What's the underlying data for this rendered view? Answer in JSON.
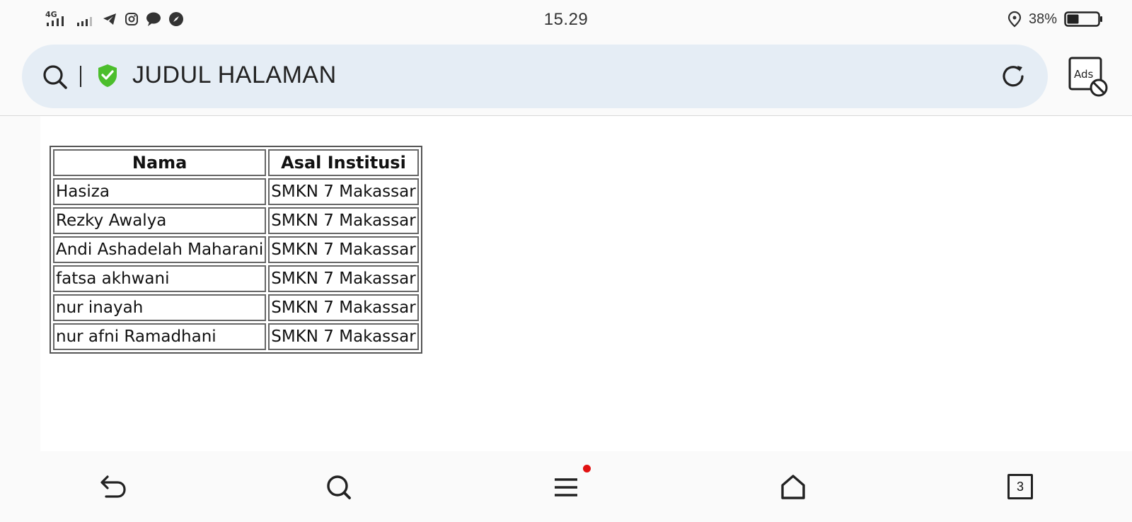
{
  "status_bar": {
    "network": "4G",
    "time": "15.29",
    "battery_percent": "38%",
    "battery_level": 0.38,
    "icons": [
      "signal-icon",
      "signal-icon",
      "telegram-icon",
      "instagram-icon",
      "chat-icon",
      "compass-icon",
      "location-icon",
      "battery-icon"
    ]
  },
  "address_bar": {
    "title": "JUDUL HALAMAN",
    "secure_color": "#4cbe2c"
  },
  "ads_button": {
    "label": "Ads"
  },
  "table": {
    "headers": [
      "Nama",
      "Asal Institusi"
    ],
    "rows": [
      [
        "Hasiza",
        "SMKN 7 Makassar"
      ],
      [
        "Rezky Awalya",
        "SMKN 7 Makassar"
      ],
      [
        "Andi Ashadelah Maharani",
        "SMKN 7 Makassar"
      ],
      [
        "fatsa akhwani",
        "SMKN 7 Makassar"
      ],
      [
        "nur inayah",
        "SMKN 7 Makassar"
      ],
      [
        "nur afni Ramadhani",
        "SMKN 7 Makassar"
      ]
    ]
  },
  "bottom_nav": {
    "tab_count": "3",
    "menu_notification_color": "#e11111"
  }
}
